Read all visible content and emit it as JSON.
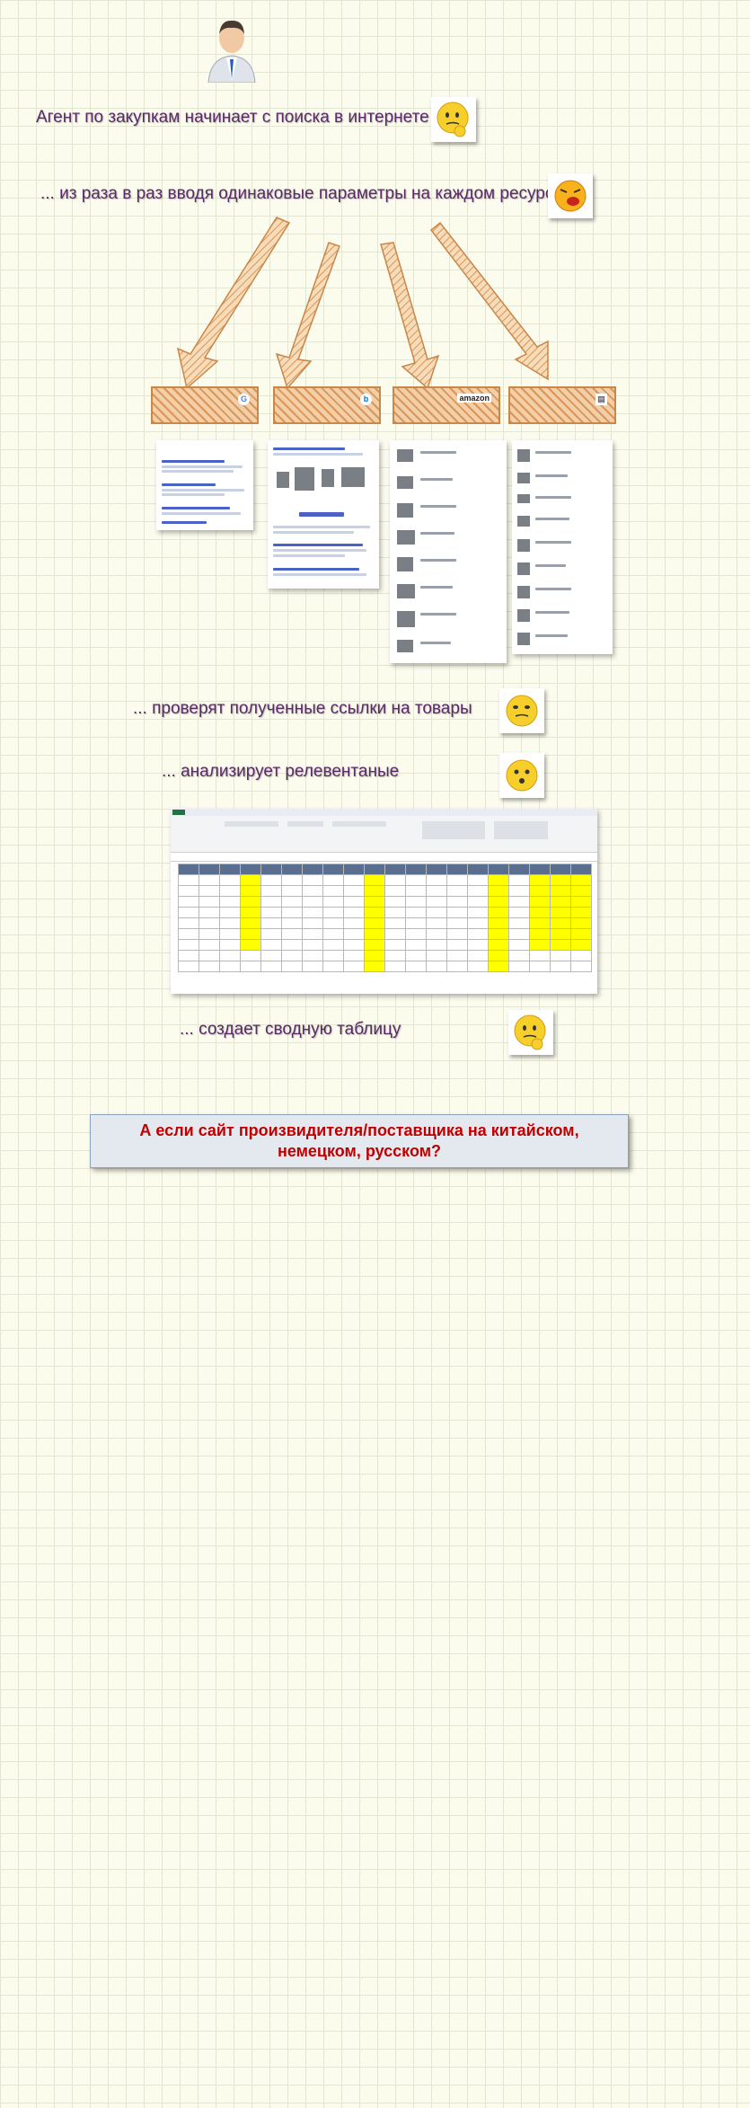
{
  "captions": {
    "search": "Агент по закупкам начинает с поиска в интернете ...",
    "params": "... из раза в раз вводя одинаковые параметры на каждом ресурсе",
    "verify": "... проверят полученные ссылки на товары",
    "analyze": "... анализирует релевентаные",
    "table": "... создает сводную таблицу"
  },
  "sources": {
    "google_icon": "G",
    "bing_icon": "b",
    "amazon": "amazon",
    "doc_icon": "▤"
  },
  "question": {
    "line1": "А если сайт произвидителя/поставщика на китайском,",
    "line2": "немецком, русском?"
  },
  "colors": {
    "caption": "#5a2a66",
    "arrow": "#d9955a",
    "question_text": "#c00000",
    "highlight": "#ffff00"
  },
  "icons": [
    "person-icon",
    "thinking-emoji-icon",
    "angry-emoji-icon",
    "confused-emoji-icon",
    "wondering-emoji-icon",
    "thinking-emoji-icon"
  ]
}
